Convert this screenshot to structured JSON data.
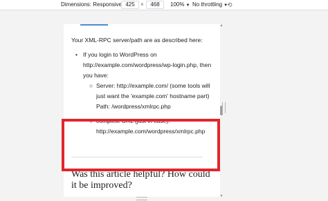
{
  "devtools": {
    "dimensions_label": "Dimensions: Responsive",
    "width_value": "425",
    "times_symbol": "×",
    "height_value": "468",
    "zoom_label": "100%",
    "throttling_label": "No throttling",
    "rotate_icon": "rotate-icon"
  },
  "article": {
    "intro": "Your XML-RPC server/path are as described here:",
    "list_item": "If you login to WordPress on http://example.com/wordpress/wp-login.php, then you have:",
    "subitems": [
      "Server: http://example.com/ (some tools will just want the 'example.com' hostname part)",
      "Path: /wordpress/xmlrpc.php",
      "complete URL (just in case): http://example.com/wordpress/xmlrpc.php"
    ],
    "feedback_heading": "Was this article helpful? How could it be improved?"
  },
  "colors": {
    "highlight": "#e1262c",
    "accent": "#4b8ad6"
  }
}
